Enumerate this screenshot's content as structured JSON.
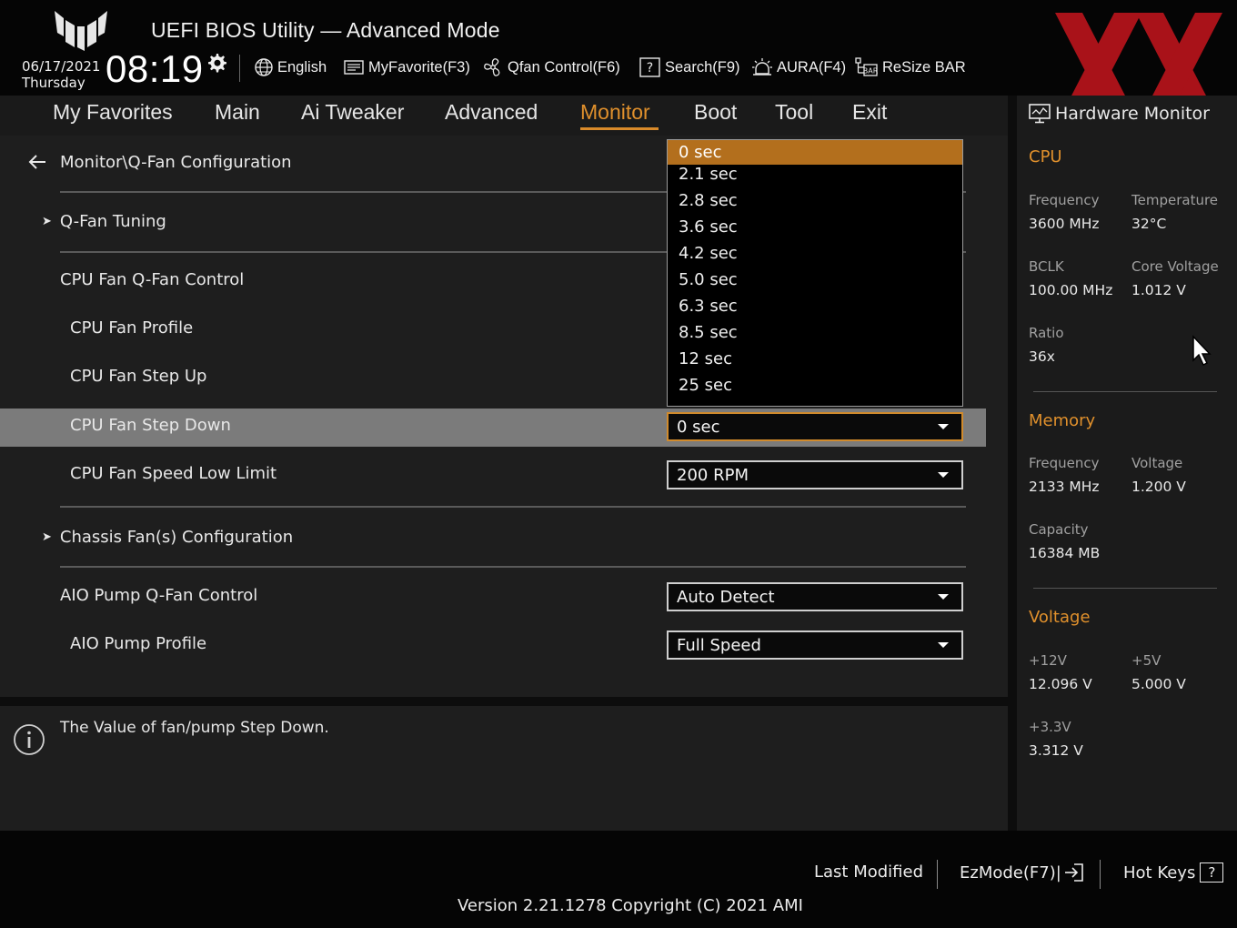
{
  "header": {
    "title": "UEFI BIOS Utility — Advanced Mode",
    "date": "06/17/2021",
    "weekday": "Thursday",
    "time": "08:19",
    "items": {
      "language": "English",
      "favorite": "MyFavorite(F3)",
      "qfan": "Qfan Control(F6)",
      "search": "Search(F9)",
      "aura": "AURA(F4)",
      "resize_bar": "ReSize BAR"
    }
  },
  "nav": {
    "tabs": [
      "My Favorites",
      "Main",
      "Ai Tweaker",
      "Advanced",
      "Monitor",
      "Boot",
      "Tool",
      "Exit"
    ],
    "active": "Monitor"
  },
  "main": {
    "breadcrumb": "Monitor\\Q-Fan Configuration",
    "qfan_tuning": "Q-Fan Tuning",
    "cpu_fan_qfan_control": "CPU Fan Q-Fan Control",
    "cpu_fan_profile": "CPU Fan Profile",
    "cpu_fan_step_up": "CPU Fan Step Up",
    "cpu_fan_step_down": {
      "label": "CPU Fan Step Down",
      "value": "0 sec"
    },
    "cpu_fan_speed_low_limit": {
      "label": "CPU Fan Speed Low Limit",
      "value": "200 RPM"
    },
    "chassis_fans": "Chassis Fan(s) Configuration",
    "aio_pump_qfan_control": {
      "label": "AIO Pump Q-Fan Control",
      "value": "Auto Detect"
    },
    "aio_pump_profile": {
      "label": "AIO Pump Profile",
      "value": "Full Speed"
    }
  },
  "dropdown": {
    "options": [
      "0 sec",
      "2.1 sec",
      "2.8 sec",
      "3.6 sec",
      "4.2 sec",
      "5.0 sec",
      "6.3 sec",
      "8.5 sec",
      "12 sec",
      "25 sec"
    ],
    "selected": "0 sec"
  },
  "help": {
    "text": "The Value of fan/pump Step Down."
  },
  "hardware_monitor": {
    "title": "Hardware Monitor",
    "cpu": {
      "section": "CPU",
      "frequency_label": "Frequency",
      "frequency": "3600 MHz",
      "temperature_label": "Temperature",
      "temperature": "32°C",
      "bclk_label": "BCLK",
      "bclk": "100.00 MHz",
      "core_voltage_label": "Core Voltage",
      "core_voltage": "1.012 V",
      "ratio_label": "Ratio",
      "ratio": "36x"
    },
    "memory": {
      "section": "Memory",
      "frequency_label": "Frequency",
      "frequency": "2133 MHz",
      "voltage_label": "Voltage",
      "voltage": "1.200 V",
      "capacity_label": "Capacity",
      "capacity": "16384 MB"
    },
    "voltage": {
      "section": "Voltage",
      "v12_label": "+12V",
      "v12": "12.096 V",
      "v5_label": "+5V",
      "v5": "5.000 V",
      "v33_label": "+3.3V",
      "v33": "3.312 V"
    }
  },
  "footer": {
    "last_modified": "Last Modified",
    "ezmode": "EzMode(F7)|",
    "hot_keys": "Hot Keys",
    "hot_keys_badge": "?",
    "version": "Version 2.21.1278 Copyright (C) 2021 AMI"
  },
  "colors": {
    "accent": "#e0902c",
    "highlight_row": "#7b7b7b",
    "dropdown_selected": "#b36f1d",
    "watermark": "#c0141c"
  }
}
